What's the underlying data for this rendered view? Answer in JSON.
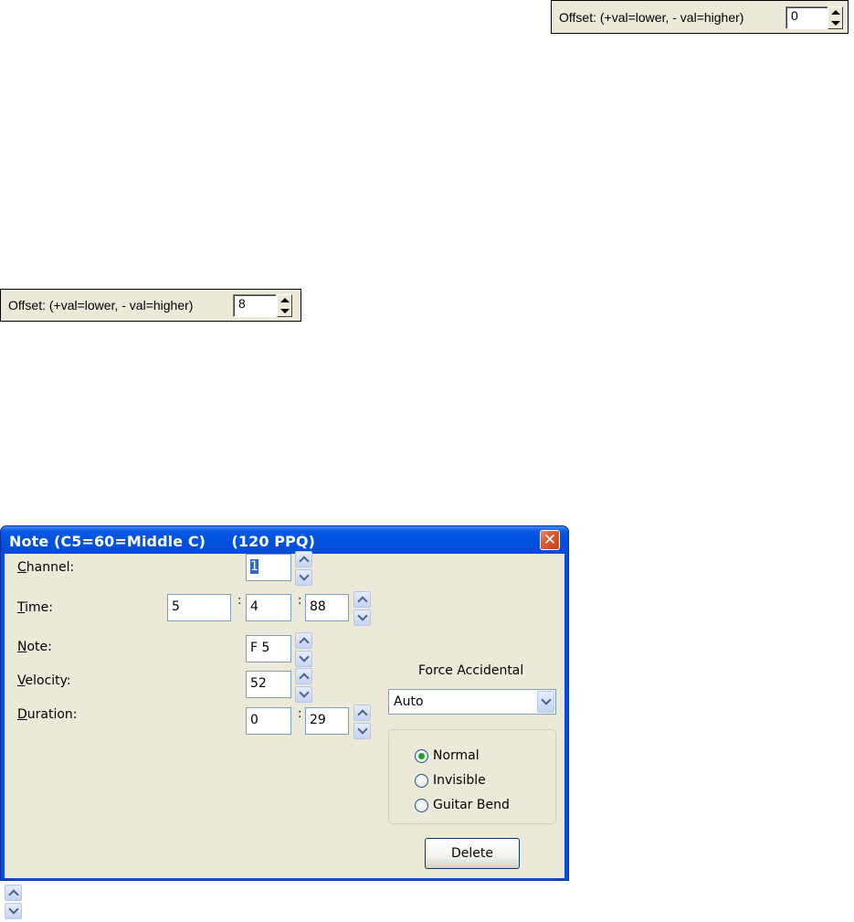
{
  "offset_widgets": [
    {
      "label": "Offset: (+val=lower, - val=higher)",
      "value": "0"
    },
    {
      "label": "Offset: (+val=lower, - val=higher)",
      "value": "8"
    }
  ],
  "dialog": {
    "title": "Note (C5=60=Middle C)     (120 PPQ)",
    "close_glyph": "✕",
    "fields": {
      "channel": {
        "label_key": "C",
        "label_rest": "hannel:",
        "value": "1"
      },
      "time": {
        "label_key": "T",
        "label_rest": "ime:",
        "bar": "5",
        "beat": "4",
        "tick": "88"
      },
      "note": {
        "label_key": "N",
        "label_rest": "ote:",
        "value": "F 5"
      },
      "velocity": {
        "label_key": "V",
        "label_rest": "elocity:",
        "value": "52"
      },
      "duration": {
        "label_key": "D",
        "label_rest": "uration:",
        "beats": "0",
        "ticks": "29"
      }
    },
    "separator": ":",
    "force_accidental": {
      "label": "Force Accidental",
      "value": "Auto"
    },
    "visibility": {
      "options": [
        "Normal",
        "Invisible",
        "Guitar Bend"
      ],
      "selected": "Normal"
    },
    "delete_label": "Delete"
  },
  "icons": {
    "spin": "spin-arrows-icon",
    "dropdown": "chevron-down-icon",
    "close": "close-icon"
  }
}
